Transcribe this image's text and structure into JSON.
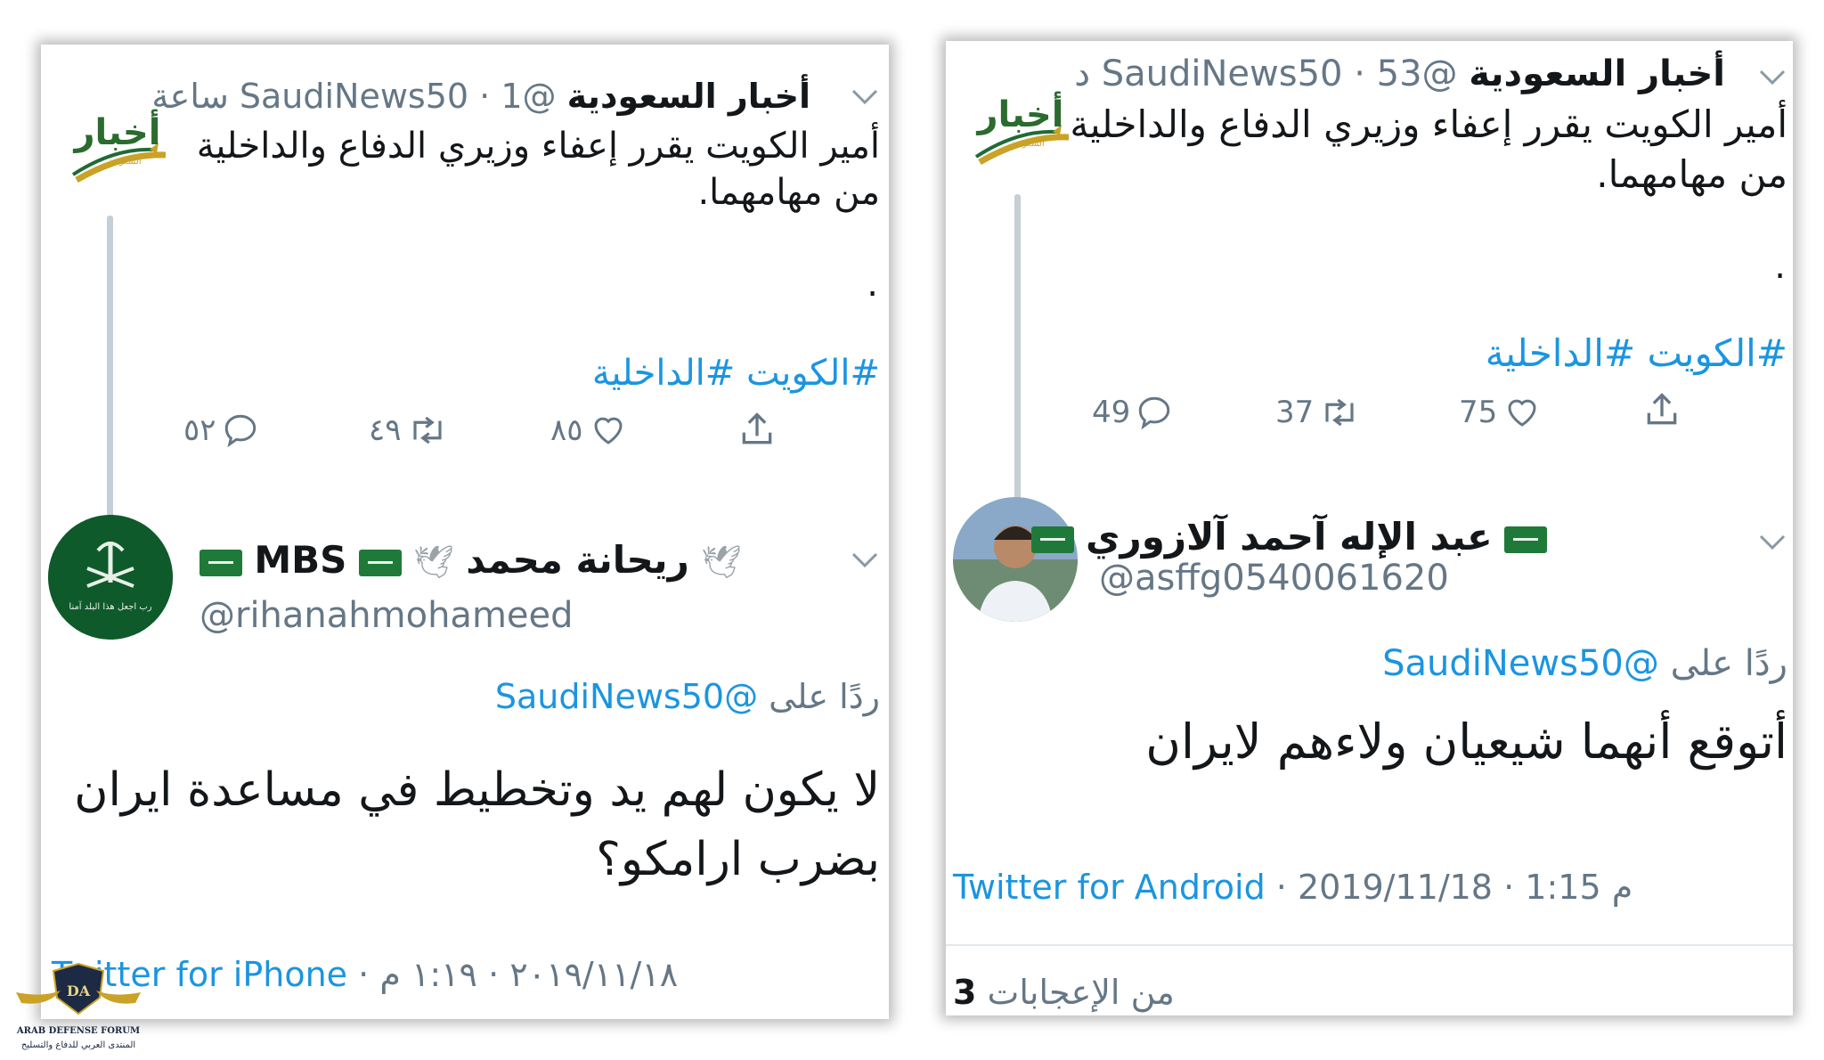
{
  "left": {
    "tweet": {
      "display_name": "أخبار السعودية",
      "handle": "@SaudiNews50",
      "time": "1 ساعة",
      "body_line1": "أمير الكويت يقرر إعفاء وزيري الدفاع والداخلية",
      "body_line2": "من مهامهما.",
      "dot": ".",
      "hashtags": "#الكويت #الداخلية",
      "replies": "٥٢",
      "retweets": "٤٩",
      "likes": "٨٥",
      "avatar_text": "أخبار",
      "avatar_subtext": "السعودية"
    },
    "reply": {
      "display_name_ar": "ريحانة محمد",
      "display_name_en": "MBS",
      "handle": "@rihanahmohameed",
      "replying_to_label": "ردًا على",
      "replying_to_handle": "@SaudiNews50",
      "text_line1": "لا يكون لهم يد وتخطيط في مساعدة ايران",
      "text_line2": "بضرب ارامكو؟",
      "avatar_caption": "رب اجعل هذا البلد آمنا"
    },
    "footer": {
      "source": "Twitter for iPhone",
      "date": "٢٠١٩/١١/١٨",
      "time": "١:١٩ م"
    }
  },
  "right": {
    "tweet": {
      "display_name": "أخبار السعودية",
      "handle": "@SaudiNews50",
      "time": "53 د",
      "body_line1": "أمير الكويت يقرر إعفاء وزيري الدفاع والداخلية",
      "body_line2": "من مهامهما.",
      "dot": ".",
      "hashtags": "#الكويت #الداخلية",
      "replies": "49",
      "retweets": "37",
      "likes": "75",
      "avatar_text": "أخبار",
      "avatar_subtext": "السعودية"
    },
    "reply": {
      "display_name": "عبد الإله آحمد آلازوري",
      "handle": "@asffg0540061620",
      "replying_to_label": "ردًا على",
      "replying_to_handle": "@SaudiNews50",
      "text": "أتوقع أنهما شيعيان ولاءهم لايران"
    },
    "footer": {
      "source": "Twitter for Android",
      "date": "2019/11/18",
      "time": "1:15 م"
    },
    "likes_summary": {
      "count": "3",
      "label": "من الإعجابات"
    }
  },
  "watermark": {
    "title": "ARAB DEFENSE FORUM",
    "subtitle": "المنتدى العربي للدفاع والتسليح",
    "mark": "DA"
  },
  "colors": {
    "link_blue": "#1b95e0",
    "meta_grey": "#657786",
    "saudi_green": "#1f6b35",
    "logo_gold": "#c9a227"
  }
}
